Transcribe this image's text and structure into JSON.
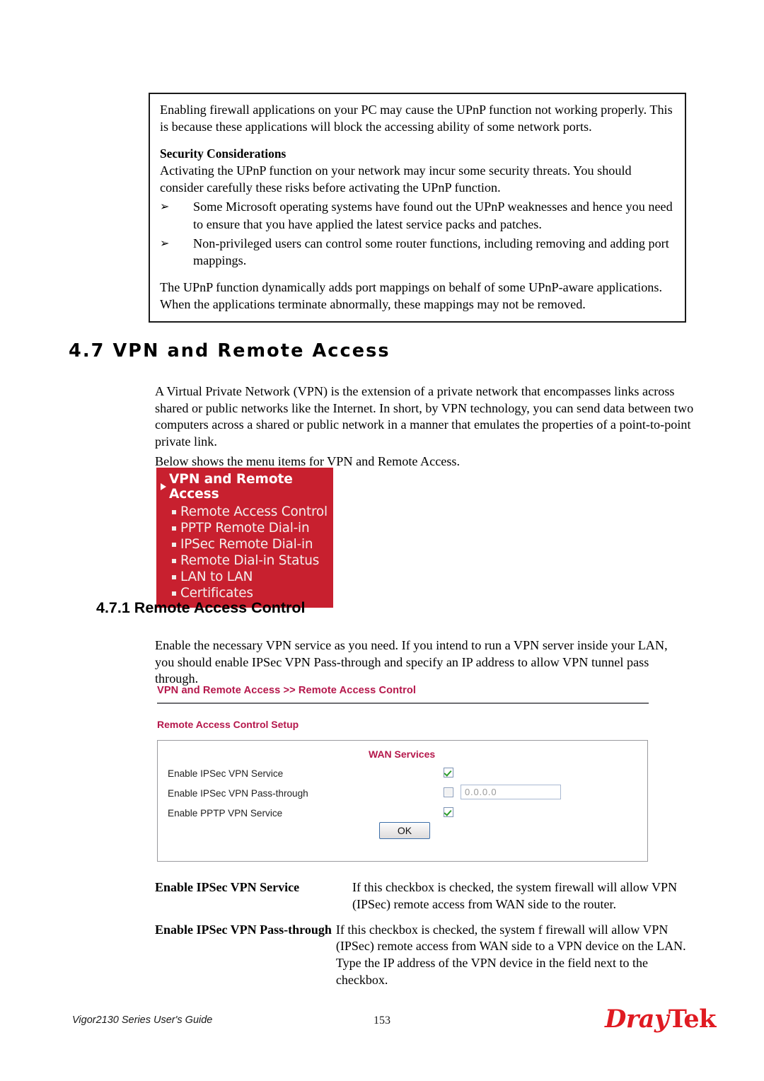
{
  "callout": {
    "paragraph_1": "Enabling firewall applications on your PC may cause the UPnP function not working properly. This is because these applications will block the accessing ability of some network ports.",
    "heading": "Security Considerations",
    "paragraph_2": "Activating the UPnP function on your network may incur some security threats. You should consider carefully these risks before activating the UPnP function.",
    "bullets": [
      {
        "marker": "➢",
        "text": "Some Microsoft operating systems have found out the UPnP weaknesses and hence you need to ensure that you have applied the latest service packs and patches."
      },
      {
        "marker": "➢",
        "text": "Non-privileged users can control some router functions, including removing and adding port mappings."
      }
    ],
    "paragraph_3": "The UPnP function dynamically adds port mappings on behalf of some UPnP-aware applications. When the applications terminate abnormally, these mappings may not be removed."
  },
  "section": {
    "heading": "4.7 VPN and Remote Access",
    "intro": "A Virtual Private Network (VPN) is the extension of a private network that encompasses links across shared or public networks like the Internet. In short, by VPN technology, you can send data between two computers across a shared or public network in a manner that emulates the properties of a point-to-point private link.",
    "menu_lead": "Below shows the menu items for VPN and Remote Access."
  },
  "menu": {
    "background_color": "#c8202f",
    "header": "VPN and Remote Access",
    "header_icon": "triangle-right-icon",
    "items": [
      {
        "label": "Remote Access Control"
      },
      {
        "label": "PPTP Remote Dial-in"
      },
      {
        "label": "IPSec Remote Dial-in"
      },
      {
        "label": "Remote Dial-in Status"
      },
      {
        "label": "LAN to LAN"
      },
      {
        "label": "Certificates"
      }
    ]
  },
  "subsection": {
    "heading": "4.7.1 Remote Access Control",
    "intro": "Enable the necessary VPN service as you need. If you intend to run a VPN server inside your LAN, you should enable IPSec VPN Pass-through and specify an IP address to allow VPN tunnel pass through."
  },
  "router_ui": {
    "accent_color": "#b5174b",
    "breadcrumb": "VPN and Remote Access >> Remote Access Control",
    "setup_label": "Remote Access Control Setup",
    "column_header": "WAN Services",
    "rows": [
      {
        "label": "Enable IPSec VPN Service",
        "checked": true,
        "has_field": false,
        "field_value": ""
      },
      {
        "label": "Enable IPSec VPN Pass-through",
        "checked": false,
        "has_field": true,
        "field_value": "0.0.0.0"
      },
      {
        "label": "Enable PPTP VPN Service",
        "checked": true,
        "has_field": false,
        "field_value": ""
      }
    ],
    "ok_label": "OK"
  },
  "definitions": [
    {
      "term": "Enable IPSec VPN Service",
      "description": "If this checkbox is checked, the system firewall will allow VPN (IPSec) remote access from WAN side to the router."
    },
    {
      "term": "Enable IPSec VPN Pass-through",
      "description": "If this checkbox is checked, the system f firewall will allow VPN (IPSec) remote access from WAN side to a VPN device on the LAN. Type the IP address of the VPN device in the field next to the checkbox."
    }
  ],
  "footer": {
    "guide": "Vigor2130 Series User's Guide",
    "page_number": "153",
    "logo_primary": "Dray",
    "logo_secondary": "Tek",
    "logo_color": "#e01b22"
  }
}
